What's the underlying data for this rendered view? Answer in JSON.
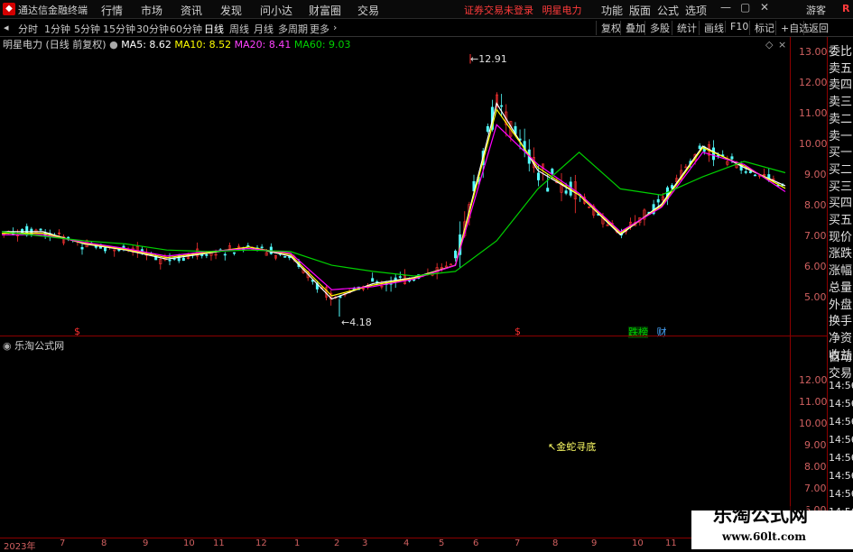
{
  "app": {
    "title": "通达信金融终端",
    "status": "证券交易未登录",
    "stock_name": "明星电力"
  },
  "menu": [
    "行情",
    "市场",
    "资讯",
    "发现",
    "问小达",
    "财富圈",
    "交易"
  ],
  "right_menu": [
    "功能",
    "版面",
    "公式",
    "选项",
    "游客"
  ],
  "window_controls": [
    "minimize-icon",
    "restore-icon",
    "close-icon"
  ],
  "periods": [
    "分时",
    "1分钟",
    "5分钟",
    "15分钟",
    "30分钟",
    "60分钟",
    "日线",
    "周线",
    "月线",
    "多周期",
    "更多"
  ],
  "active_period": "日线",
  "tool_buttons": [
    "复权",
    "叠加",
    "多股",
    "统计",
    "画线",
    "F10",
    "标记",
    "+自选",
    "返回"
  ],
  "info": {
    "title": "明星电力 (日线 前复权)",
    "ma5": "MA5: 8.62",
    "ma10": "MA10: 8.52",
    "ma20": "MA20: 8.41",
    "ma60": "MA60: 9.03"
  },
  "colors": {
    "up": "#ff3232",
    "down": "#54ffff",
    "ma5": "#ffffff",
    "ma10": "#ffff00",
    "ma20": "#ff00ff",
    "ma60": "#00d000",
    "axis": "#8b0000"
  },
  "main_y_labels": [
    "13.00",
    "12.00",
    "11.00",
    "10.00",
    "9.00",
    "8.00",
    "7.00",
    "6.00",
    "5.00"
  ],
  "annotations": {
    "high": "12.91",
    "low": "4.18",
    "marker_a": "$",
    "marker_b": "$",
    "tag1": "跌榜",
    "tag2": "财"
  },
  "side_labels": [
    "委比",
    "卖五",
    "卖四",
    "卖三",
    "卖二",
    "卖一",
    "买一",
    "买二",
    "买三",
    "买四",
    "买五",
    "现价",
    "涨跌",
    "涨幅",
    "总量",
    "外盘",
    "换手",
    "净资",
    "收益",
    "自动",
    "交易",
    "14:56",
    "14:56",
    "14:56",
    "14:56",
    "14:56",
    "14:56",
    "14:56",
    "14:56"
  ],
  "sub": {
    "title": "乐淘公式网",
    "label": "金蛇寻底"
  },
  "sub_y_labels": [
    "12.00",
    "11.00",
    "10.00",
    "9.00",
    "8.00",
    "7.00",
    "6.00"
  ],
  "x_labels": [
    "2023年",
    "7",
    "8",
    "9",
    "10",
    "11",
    "12",
    "1",
    "2",
    "3",
    "4",
    "5",
    "6",
    "7",
    "8",
    "9",
    "10",
    "11"
  ],
  "watermark": {
    "title": "乐淘公式网",
    "url": "www.60lt.com"
  },
  "chart_data": {
    "type": "line",
    "title": "明星电力 (日线 前复权)",
    "x": [
      "2023年",
      "7",
      "8",
      "9",
      "10",
      "11",
      "12",
      "1",
      "2",
      "3",
      "4",
      "5",
      "6",
      "7",
      "8",
      "9",
      "10",
      "11"
    ],
    "ylim": [
      4.5,
      13.2
    ],
    "series": [
      {
        "name": "MA5",
        "values": [
          7.1,
          7.1,
          6.7,
          6.5,
          6.2,
          6.4,
          6.6,
          6.3,
          4.9,
          5.4,
          5.6,
          6.0,
          11.3,
          9.1,
          8.3,
          7.0,
          8.0,
          9.9,
          9.2,
          8.6
        ]
      },
      {
        "name": "MA10",
        "values": [
          7.05,
          7.05,
          6.72,
          6.52,
          6.25,
          6.42,
          6.6,
          6.35,
          5.0,
          5.35,
          5.58,
          6.0,
          11.1,
          9.2,
          8.3,
          7.05,
          7.95,
          9.85,
          9.25,
          8.52
        ]
      },
      {
        "name": "MA20",
        "values": [
          7.0,
          7.0,
          6.75,
          6.55,
          6.3,
          6.45,
          6.55,
          6.4,
          5.2,
          5.3,
          5.55,
          6.0,
          10.6,
          9.3,
          8.35,
          7.1,
          7.9,
          9.7,
          9.3,
          8.41
        ]
      },
      {
        "name": "MA60",
        "values": [
          7.1,
          6.95,
          6.8,
          6.7,
          6.5,
          6.45,
          6.5,
          6.45,
          6.0,
          5.8,
          5.65,
          5.8,
          6.8,
          8.5,
          9.7,
          8.5,
          8.3,
          8.9,
          9.4,
          9.03
        ]
      }
    ],
    "extremes": {
      "high": 12.91,
      "low": 4.18
    },
    "grid": false
  }
}
